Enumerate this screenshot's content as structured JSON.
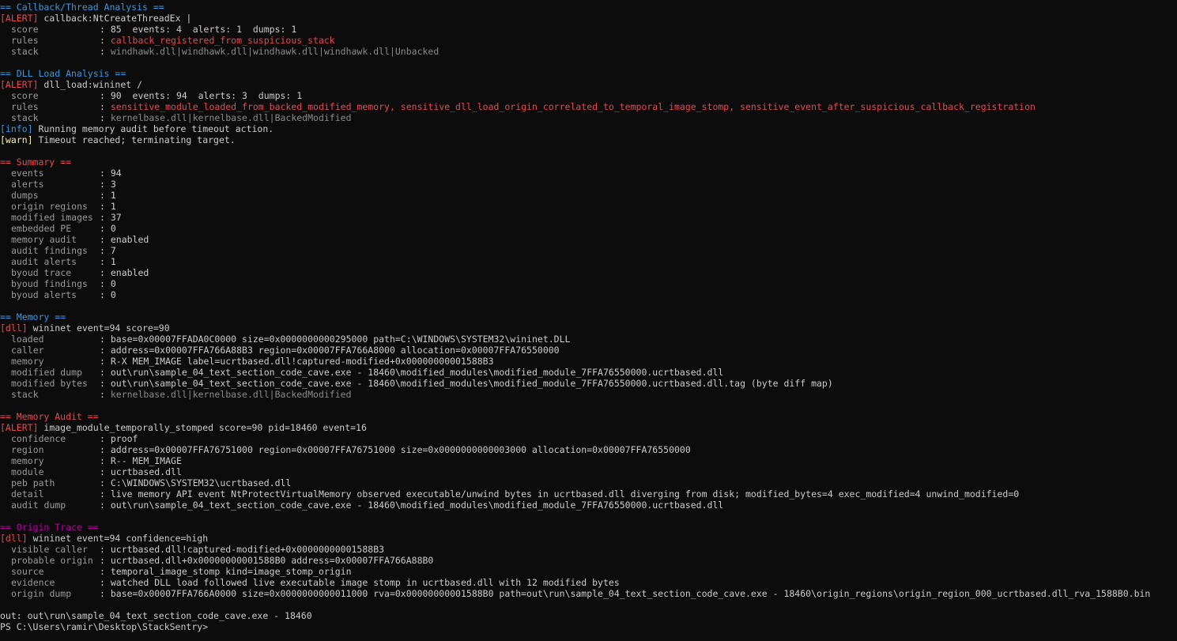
{
  "sections": {
    "callback": {
      "header": "== Callback/Thread Analysis ==",
      "alert_tag": "[ALERT]",
      "alert_text": "callback:NtCreateThreadEx",
      "rows": [
        {
          "k": "score",
          "v": "85  events: 4  alerts: 1  dumps: 1",
          "cls": "white"
        },
        {
          "k": "rules",
          "v": "callback_registered_from_suspicious_stack",
          "cls": "red"
        },
        {
          "k": "stack",
          "v": "windhawk.dll|windhawk.dll|windhawk.dll|windhawk.dll|Unbacked",
          "cls": "dim"
        }
      ]
    },
    "dll_load": {
      "header": "== DLL Load Analysis ==",
      "alert_tag": "[ALERT]",
      "alert_text": "dll_load:wininet /",
      "rows": [
        {
          "k": "score",
          "v": "90  events: 94  alerts: 3  dumps: 1",
          "cls": "white"
        },
        {
          "k": "rules",
          "v": "sensitive_module_loaded_from_backed_modified_memory, sensitive_dll_load_origin_correlated_to_temporal_image_stomp, sensitive_event_after_suspicious_callback_registration",
          "cls": "red"
        },
        {
          "k": "stack",
          "v": "kernelbase.dll|kernelbase.dll|BackedModified",
          "cls": "dim"
        }
      ],
      "info_tag": "[info]",
      "info_text": "Running memory audit before timeout action.",
      "warn_tag": "[warn]",
      "warn_text": "Timeout reached; terminating target."
    },
    "summary": {
      "header": "== Summary ==",
      "rows": [
        {
          "k": "events",
          "v": "94"
        },
        {
          "k": "alerts",
          "v": "3"
        },
        {
          "k": "dumps",
          "v": "1"
        },
        {
          "k": "origin regions",
          "v": "1"
        },
        {
          "k": "modified images",
          "v": "37"
        },
        {
          "k": "embedded PE",
          "v": "0"
        },
        {
          "k": "memory audit",
          "v": "enabled"
        },
        {
          "k": "audit findings",
          "v": "7"
        },
        {
          "k": "audit alerts",
          "v": "1"
        },
        {
          "k": "byoud trace",
          "v": "enabled"
        },
        {
          "k": "byoud findings",
          "v": "0"
        },
        {
          "k": "byoud alerts",
          "v": "0"
        }
      ]
    },
    "memory": {
      "header": "== Memory ==",
      "tag": "[dll]",
      "tag_text": "wininet event=94 score=90",
      "rows": [
        {
          "k": "loaded",
          "v": "base=0x00007FFADA0C0000 size=0x0000000000295000 path=C:\\WINDOWS\\SYSTEM32\\wininet.DLL",
          "cls": "white"
        },
        {
          "k": "caller",
          "v": "address=0x00007FFA766A88B3 region=0x00007FFA766A8000 allocation=0x00007FFA76550000",
          "cls": "white"
        },
        {
          "k": "memory",
          "v": "R-X MEM_IMAGE label=ucrtbased.dll!captured-modified+0x00000000001588B3",
          "cls": "white"
        },
        {
          "k": "modified dump",
          "v": "out\\run\\sample_04_text_section_code_cave.exe - 18460\\modified_modules\\modified_module_7FFA76550000.ucrtbased.dll",
          "cls": "white"
        },
        {
          "k": "modified bytes",
          "v": "out\\run\\sample_04_text_section_code_cave.exe - 18460\\modified_modules\\modified_module_7FFA76550000.ucrtbased.dll.tag (byte diff map)",
          "cls": "white"
        },
        {
          "k": "stack",
          "v": "kernelbase.dll|kernelbase.dll|BackedModified",
          "cls": "dim"
        }
      ]
    },
    "memory_audit": {
      "header": "== Memory Audit ==",
      "alert_tag": "[ALERT]",
      "alert_text": "image_module_temporally_stomped score=90 pid=18460 event=16",
      "rows": [
        {
          "k": "confidence",
          "v": "proof"
        },
        {
          "k": "region",
          "v": "address=0x00007FFA76751000 region=0x00007FFA76751000 size=0x0000000000003000 allocation=0x00007FFA76550000"
        },
        {
          "k": "memory",
          "v": "R-- MEM_IMAGE"
        },
        {
          "k": "module",
          "v": "ucrtbased.dll"
        },
        {
          "k": "peb path",
          "v": "C:\\WINDOWS\\SYSTEM32\\ucrtbased.dll"
        },
        {
          "k": "detail",
          "v": "live memory API event NtProtectVirtualMemory observed executable/unwind bytes in ucrtbased.dll diverging from disk; modified_bytes=4 exec_modified=4 unwind_modified=0"
        },
        {
          "k": "audit dump",
          "v": "out\\run\\sample_04_text_section_code_cave.exe - 18460\\modified_modules\\modified_module_7FFA76550000.ucrtbased.dll"
        }
      ]
    },
    "origin_trace": {
      "header": "== Origin Trace ==",
      "tag": "[dll]",
      "tag_text": "wininet event=94 confidence=high",
      "rows": [
        {
          "k": "visible caller",
          "v": "ucrtbased.dll!captured-modified+0x00000000001588B3"
        },
        {
          "k": "probable origin",
          "v": "ucrtbased.dll+0x00000000001588B0 address=0x00007FFA766A88B0"
        },
        {
          "k": "source",
          "v": "temporal_image_stomp kind=image_stomp_origin"
        },
        {
          "k": "evidence",
          "v": "watched DLL load followed live executable image stomp in ucrtbased.dll with 12 modified bytes"
        },
        {
          "k": "origin dump",
          "v": "base=0x00007FFA766A0000 size=0x0000000000011000 rva=0x00000000001588B0 path=out\\run\\sample_04_text_section_code_cave.exe - 18460\\origin_regions\\origin_region_000_ucrtbased.dll_rva_1588B0.bin"
        }
      ]
    }
  },
  "footer": {
    "out_line": "out: out\\run\\sample_04_text_section_code_cave.exe - 18460",
    "prompt": "PS C:\\Users\\ramir\\Desktop\\StackSentry>"
  },
  "colors": {
    "background": "#0c0c0c",
    "text": "#cccccc",
    "header_cyan": "#3a96dd",
    "alert_red": "#e74856",
    "origin_magenta": "#b4009e",
    "warn_yellow": "#f9f1a5"
  }
}
